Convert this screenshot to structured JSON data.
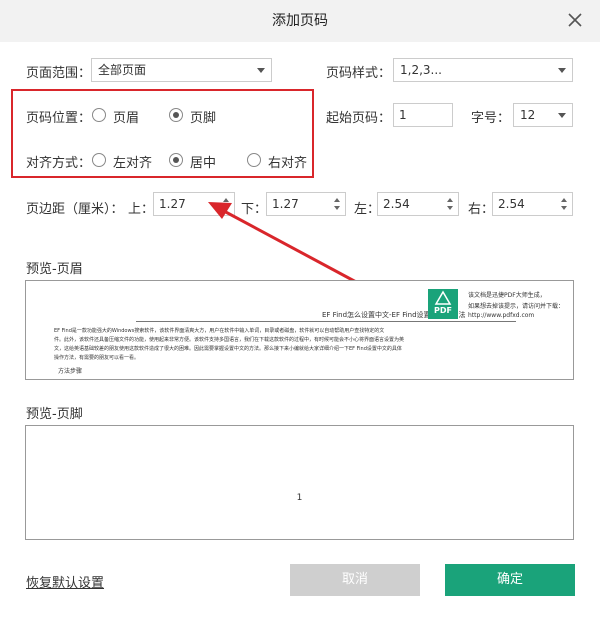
{
  "dialog": {
    "title": "添加页码"
  },
  "range": {
    "label": "页面范围：",
    "value": "全部页面"
  },
  "style": {
    "label": "页码样式：",
    "value": "1,2,3..."
  },
  "position": {
    "label": "页码位置：",
    "options": [
      "页眉",
      "页脚"
    ],
    "selected": "页脚"
  },
  "start": {
    "label": "起始页码：",
    "value": "1"
  },
  "fontsize": {
    "label": "字号：",
    "value": "12"
  },
  "align": {
    "label": "对齐方式：",
    "options": [
      "左对齐",
      "居中",
      "右对齐"
    ],
    "selected": "居中"
  },
  "margins": {
    "label": "页边距（厘米）：",
    "top_label": "上：",
    "top": "1.27",
    "bottom_label": "下：",
    "bottom": "1.27",
    "left_label": "左：",
    "left": "2.54",
    "right_label": "右：",
    "right": "2.54"
  },
  "preview_header": {
    "label": "预览-页眉",
    "doc_title": "EF Find怎么设置中文-EF Find设置中文的方法",
    "body_intro": "EF Find是一款功能强大的Windows搜索软件，该软件界面清爽大方，用户在软件中输入单词，目录或者磁盘，软件就可以自动帮助用户查找特定的文",
    "body_line2": "件。此外，该软件还具备压缩文件的功能，使用起来非常方便。该软件支持多国语言，我们在下载这款软件的过程中，有时候可能会不小心将界面语言设置为英",
    "body_line3": "文，这给英语基础较差的朋友使用这款软件造成了很大的困难。因此需要掌握设置中文的方法。那么接下来小编就给大家详细介绍一下EF Find设置中文的具体",
    "body_line4": "操作方法，有需要的朋友可以看一看。",
    "section": "方法步骤"
  },
  "watermark": {
    "logo_text": "PDF",
    "line1": "该文档是迅捷PDF大师生成，",
    "line2": "如果想去掉该提示，请访问并下载：",
    "line3": "http://www.pdfxd.com"
  },
  "preview_footer": {
    "label": "预览-页脚",
    "page_number": "1"
  },
  "footer": {
    "reset_label": "恢复默认设置",
    "cancel_label": "取消",
    "ok_label": "确定"
  },
  "colors": {
    "accent": "#1aa37a",
    "cancel_bg": "#cfcfcf",
    "highlight_box": "#d9262b",
    "arrow": "#d9262b"
  }
}
